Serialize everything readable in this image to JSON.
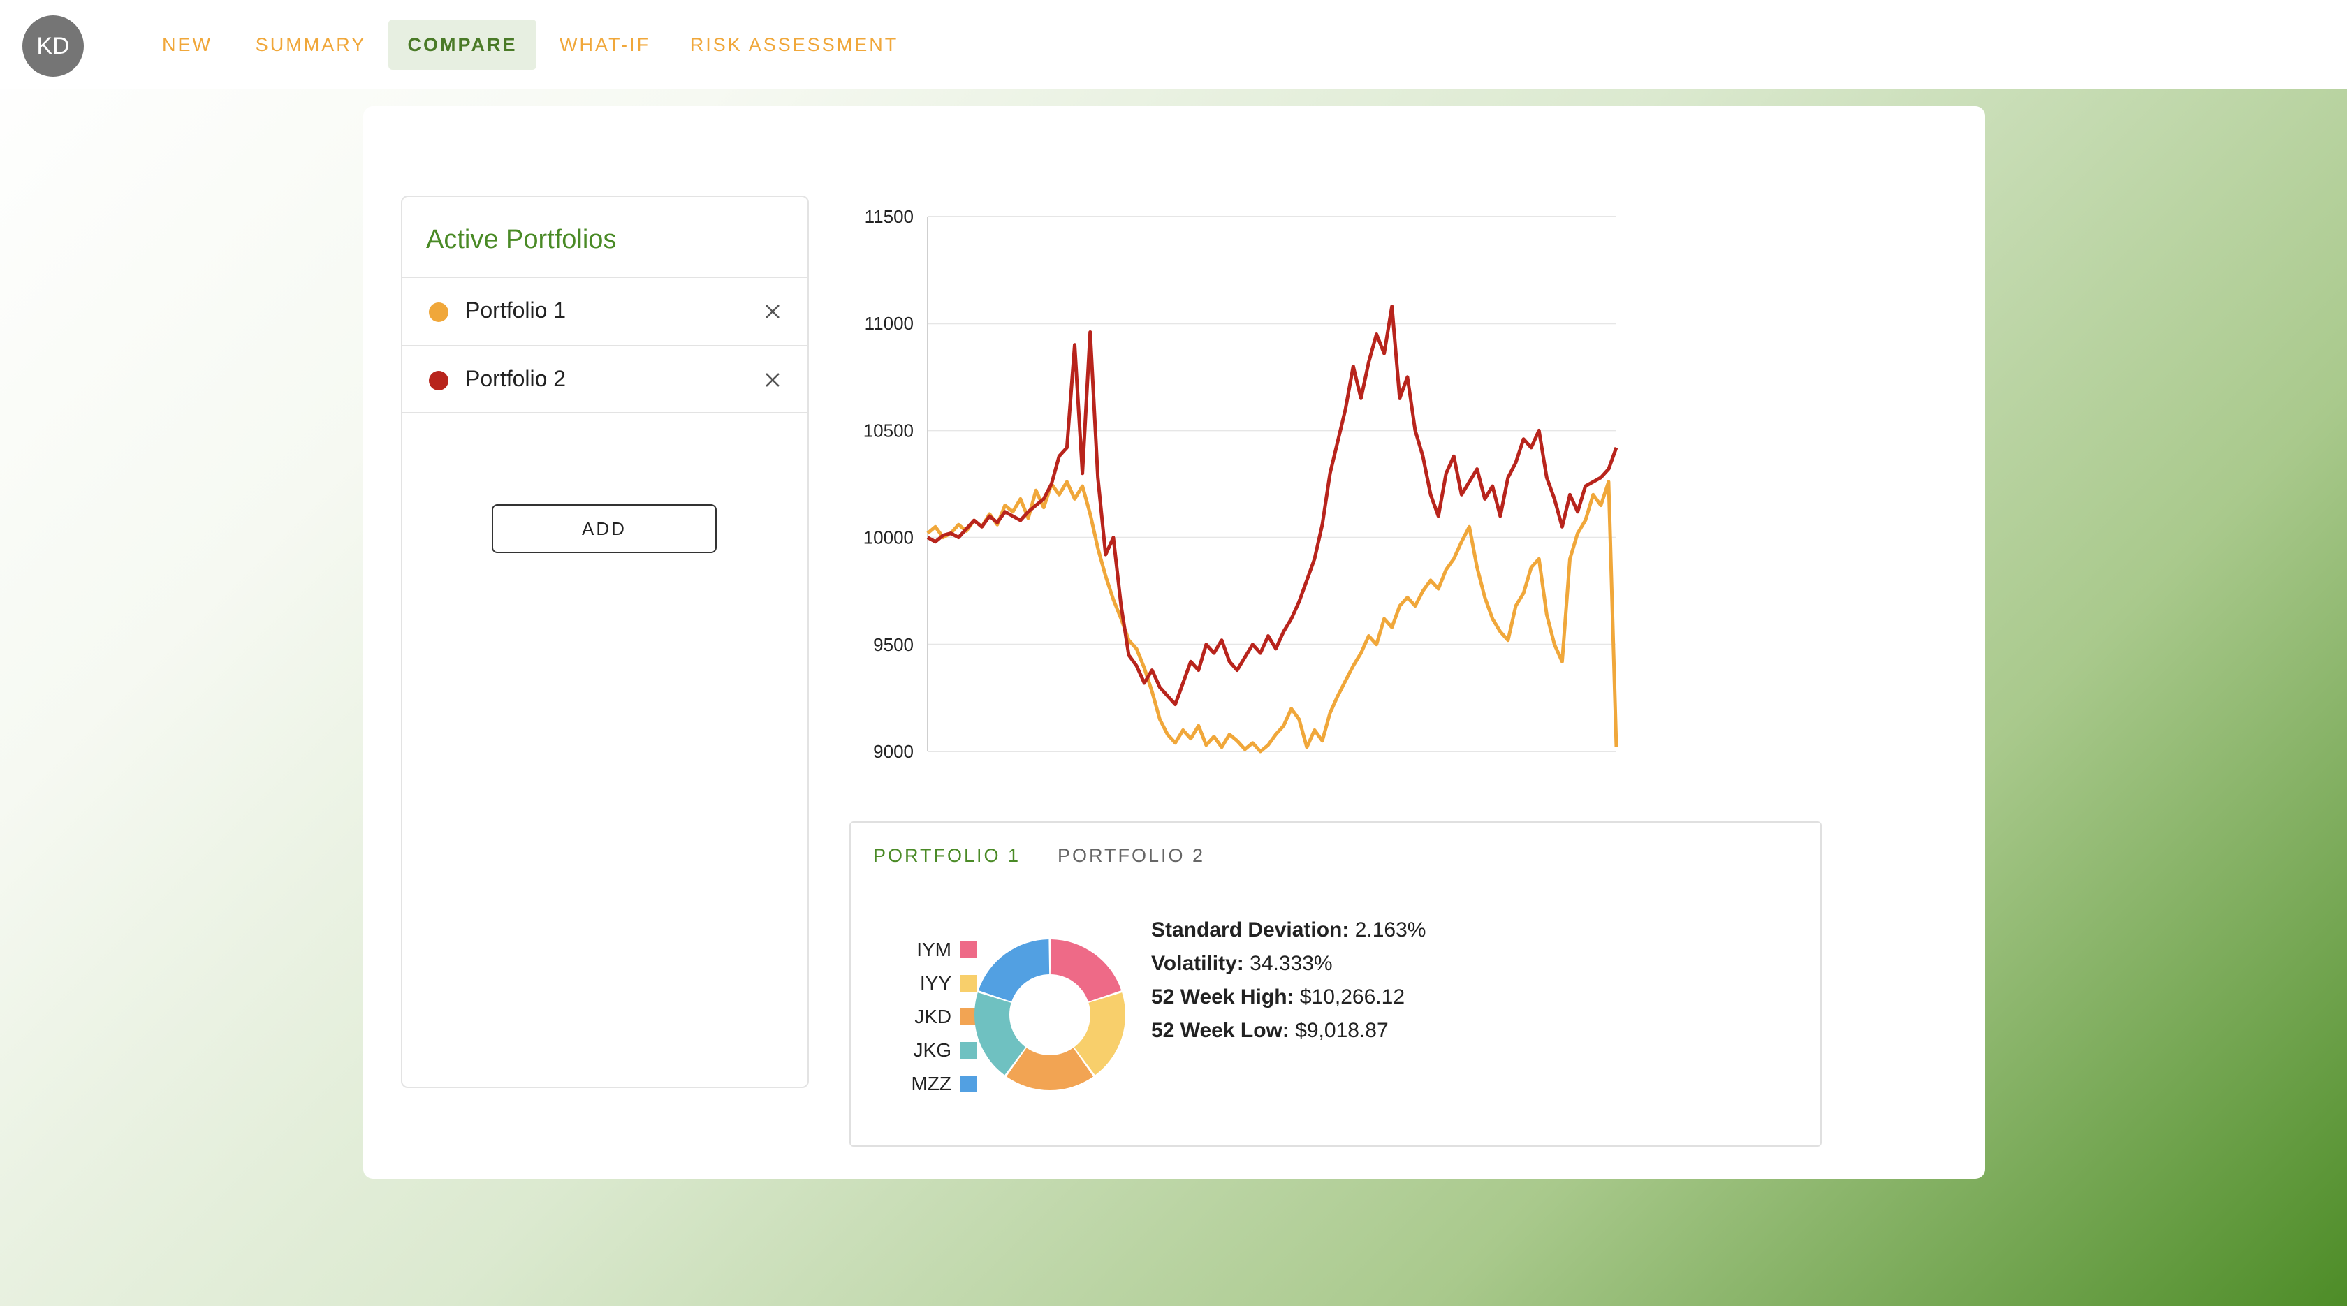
{
  "user": {
    "initials": "KD"
  },
  "nav": {
    "items": [
      {
        "label": "NEW"
      },
      {
        "label": "SUMMARY"
      },
      {
        "label": "COMPARE",
        "active": true
      },
      {
        "label": "WHAT-IF"
      },
      {
        "label": "RISK ASSESSMENT"
      }
    ]
  },
  "portfolios_panel": {
    "title": "Active Portfolios",
    "items": [
      {
        "label": "Portfolio 1",
        "color": "#f0a73a"
      },
      {
        "label": "Portfolio 2",
        "color": "#b8241c"
      }
    ],
    "add_label": "ADD"
  },
  "chart_data": {
    "type": "line",
    "ylim": [
      9000,
      11500
    ],
    "y_ticks": [
      "11500",
      "11000",
      "10500",
      "10000",
      "9500",
      "9000"
    ],
    "xlabel": "",
    "ylabel": "",
    "grid": true,
    "series": [
      {
        "color": "#f0a73a",
        "values": [
          10020,
          10050,
          10000,
          10020,
          10060,
          10030,
          10080,
          10050,
          10110,
          10060,
          10150,
          10120,
          10180,
          10090,
          10220,
          10140,
          10250,
          10200,
          10260,
          10180,
          10240,
          10110,
          9950,
          9820,
          9710,
          9620,
          9520,
          9480,
          9390,
          9280,
          9150,
          9080,
          9040,
          9100,
          9060,
          9120,
          9030,
          9070,
          9020,
          9080,
          9050,
          9010,
          9040,
          9000,
          9030,
          9080,
          9120,
          9200,
          9150,
          9020,
          9100,
          9050,
          9180,
          9260,
          9330,
          9400,
          9460,
          9540,
          9500,
          9620,
          9580,
          9680,
          9720,
          9680,
          9750,
          9800,
          9760,
          9850,
          9900,
          9980,
          10050,
          9860,
          9720,
          9620,
          9560,
          9520,
          9680,
          9740,
          9860,
          9900,
          9640,
          9500,
          9420,
          9900,
          10020,
          10080,
          10200,
          10150,
          10260,
          9020
        ]
      },
      {
        "color": "#b8241c",
        "values": [
          10000,
          9980,
          10010,
          10020,
          10000,
          10040,
          10080,
          10050,
          10100,
          10070,
          10120,
          10100,
          10080,
          10120,
          10150,
          10180,
          10250,
          10380,
          10420,
          10900,
          10300,
          10960,
          10280,
          9920,
          10000,
          9680,
          9450,
          9400,
          9320,
          9380,
          9300,
          9260,
          9220,
          9320,
          9420,
          9380,
          9500,
          9460,
          9520,
          9420,
          9380,
          9440,
          9500,
          9460,
          9540,
          9480,
          9560,
          9620,
          9700,
          9800,
          9900,
          10060,
          10300,
          10450,
          10600,
          10800,
          10650,
          10820,
          10950,
          10860,
          11080,
          10650,
          10750,
          10500,
          10380,
          10200,
          10100,
          10300,
          10380,
          10200,
          10260,
          10320,
          10180,
          10240,
          10100,
          10280,
          10350,
          10460,
          10420,
          10500,
          10280,
          10180,
          10050,
          10200,
          10120,
          10240,
          10260,
          10280,
          10320,
          10420
        ]
      }
    ]
  },
  "stats_card": {
    "tabs": [
      {
        "label": "PORTFOLIO 1",
        "active": true
      },
      {
        "label": "PORTFOLIO 2"
      }
    ],
    "allocation_chart": {
      "type": "pie",
      "labels": [
        "IYM",
        "IYY",
        "JKD",
        "JKG",
        "MZZ"
      ],
      "values": [
        20,
        20,
        20,
        20,
        20
      ],
      "colors": [
        "#ee6a87",
        "#f8cf6b",
        "#f2a453",
        "#6fc1c1",
        "#52a0e2"
      ]
    },
    "metrics": [
      {
        "label": "Standard Deviation:",
        "value": "2.163%"
      },
      {
        "label": "Volatility:",
        "value": "34.333%"
      },
      {
        "label": "52 Week High:",
        "value": "$10,266.12"
      },
      {
        "label": "52 Week Low:",
        "value": "$9,018.87"
      }
    ]
  }
}
